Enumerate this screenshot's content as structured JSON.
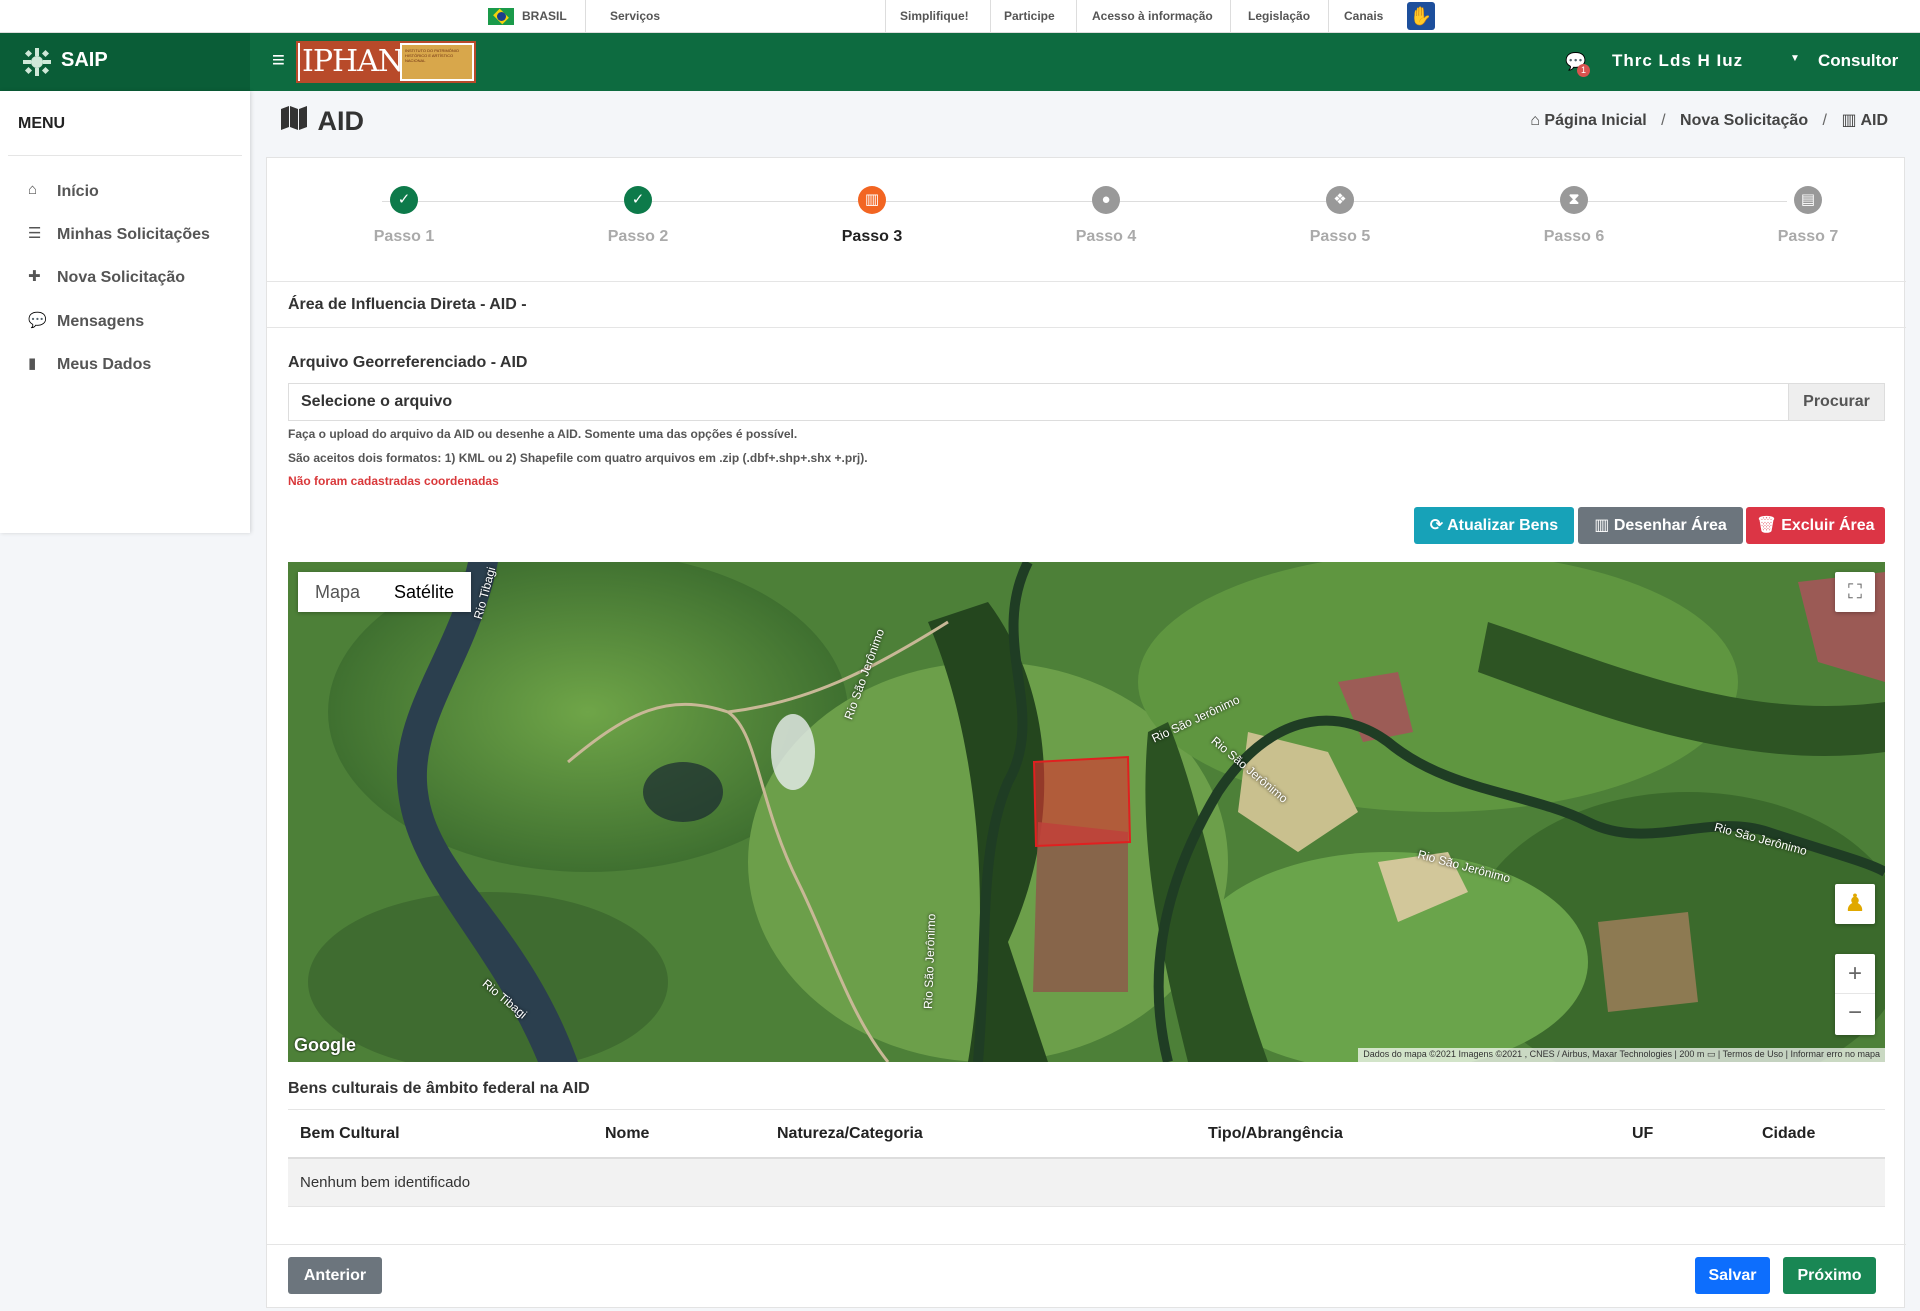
{
  "govbar": {
    "country": "BRASIL",
    "services": "Serviços",
    "links": [
      "Simplifique!",
      "Participe",
      "Acesso à informação",
      "Legislação",
      "Canais"
    ]
  },
  "header": {
    "brand": "SAIP",
    "logo_text": "IPHAN",
    "logo_sub": "INSTITUTO DO PATRIMÔNIO HISTÓRICO E ARTÍSTICO NACIONAL",
    "notifications_badge": "1",
    "user_name": "Thrc Lds H Iuz",
    "role": "Consultor"
  },
  "sidebar": {
    "title": "MENU",
    "items": [
      {
        "icon": "home-icon",
        "label": "Início"
      },
      {
        "icon": "list-icon",
        "label": "Minhas Solicitações"
      },
      {
        "icon": "plus-icon",
        "label": "Nova Solicitação"
      },
      {
        "icon": "comments-icon",
        "label": "Mensagens"
      },
      {
        "icon": "file-icon",
        "label": "Meus Dados"
      }
    ]
  },
  "page": {
    "title": "AID",
    "breadcrumb": [
      "Página Inicial",
      "Nova Solicitação",
      "AID"
    ]
  },
  "steps": [
    {
      "label": "Passo 1",
      "state": "done"
    },
    {
      "label": "Passo 2",
      "state": "done"
    },
    {
      "label": "Passo 3",
      "state": "active"
    },
    {
      "label": "Passo 4",
      "state": "todo"
    },
    {
      "label": "Passo 5",
      "state": "todo"
    },
    {
      "label": "Passo 6",
      "state": "todo"
    },
    {
      "label": "Passo 7",
      "state": "todo"
    }
  ],
  "form": {
    "section_title": "Área de Influencia Direta - AID -",
    "file_label": "Arquivo Georreferenciado - AID",
    "file_placeholder": "Selecione o arquivo",
    "browse": "Procurar",
    "help1": "Faça o upload do arquivo da AID ou desenhe a AID. Somente uma das opções é possível.",
    "help2": "São aceitos dois formatos: 1) KML ou 2) Shapefile com quatro arquivos em .zip (.dbf+.shp+.shx +.prj).",
    "error": "Não foram cadastradas coordenadas",
    "btn_update": "Atualizar Bens",
    "btn_draw": "Desenhar Área",
    "btn_delete": "Excluir Área"
  },
  "map": {
    "type_map": "Mapa",
    "type_satellite": "Satélite",
    "google": "Google",
    "attribution": "Dados do mapa ©2021 Imagens ©2021 , CNES / Airbus, Maxar Technologies",
    "scale": "200 m",
    "terms": "Termos de Uso",
    "report": "Informar erro no mapa",
    "labels": [
      "Rio Tibagi",
      "Rio Tibagi",
      "Rio São Jerônimo",
      "Rio São Jerônimo",
      "Rio São Jerônimo",
      "Rio São Jerônimo",
      "Rio São Jerônimo",
      "Rio São Jerônimo"
    ]
  },
  "table": {
    "title": "Bens culturais de âmbito federal na AID",
    "columns": [
      "Bem Cultural",
      "Nome",
      "Natureza/Categoria",
      "Tipo/Abrangência",
      "UF",
      "Cidade"
    ],
    "empty": "Nenhum bem identificado"
  },
  "footer": {
    "prev": "Anterior",
    "save": "Salvar",
    "next": "Próximo"
  },
  "colors": {
    "header": "#0d6b40",
    "active_step": "#f26522",
    "done_step": "#0d7a4a"
  }
}
